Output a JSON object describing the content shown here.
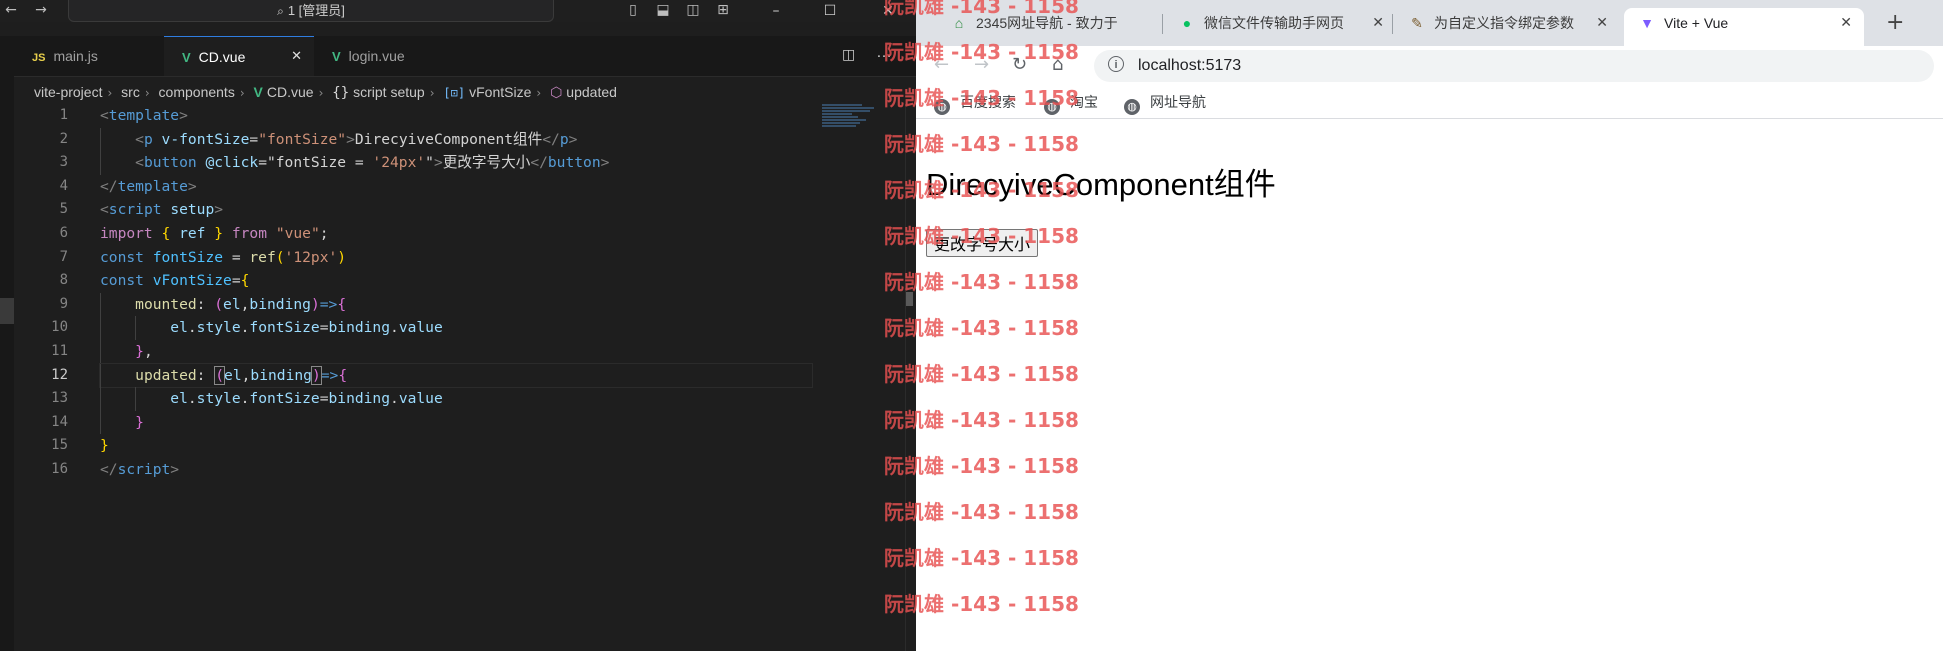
{
  "vscode": {
    "command_center": "1 [管理员]",
    "tabs": [
      {
        "label": "main.js",
        "icon": "JS"
      },
      {
        "label": "CD.vue",
        "icon": "V"
      },
      {
        "label": "login.vue",
        "icon": "V"
      }
    ],
    "breadcrumb": [
      "vite-project",
      "src",
      "components",
      "CD.vue",
      "script setup",
      "vFontSize",
      "updated"
    ],
    "line_numbers": [
      "1",
      "2",
      "3",
      "4",
      "5",
      "6",
      "7",
      "8",
      "9",
      "10",
      "11",
      "12",
      "13",
      "14",
      "15",
      "16"
    ],
    "code": {
      "l1_a": "<",
      "l1_b": "template",
      "l1_c": ">",
      "l2_a": "<",
      "l2_b": "p",
      "l2_c": "v-fontSize",
      "l2_d": "=",
      "l2_e": "\"fontSize\"",
      "l2_f": ">",
      "l2_g": "DirecyiveComponent组件",
      "l2_h": "</",
      "l2_i": "p",
      "l2_j": ">",
      "l3_a": "<",
      "l3_b": "button",
      "l3_c": "@click",
      "l3_d": "=",
      "l3_e": "\"fontSize = ",
      "l3_f": "'24px'",
      "l3_g": "\"",
      "l3_h": ">",
      "l3_i": "更改字号大小",
      "l3_j": "</",
      "l3_k": "button",
      "l3_l": ">",
      "l4_a": "</",
      "l4_b": "template",
      "l4_c": ">",
      "l5_a": "<",
      "l5_b": "script",
      "l5_c": "setup",
      "l5_d": ">",
      "l6_a": "import",
      "l6_b": "{",
      "l6_c": "ref",
      "l6_d": "}",
      "l6_e": "from",
      "l6_f": "\"vue\"",
      "l6_g": ";",
      "l7_a": "const",
      "l7_b": "fontSize",
      "l7_c": " = ",
      "l7_d": "ref",
      "l7_e": "(",
      "l7_f": "'12px'",
      "l7_g": ")",
      "l8_a": "const",
      "l8_b": "vFontSize",
      "l8_c": "=",
      "l8_d": "{",
      "l9_a": "mounted",
      "l9_b": ": ",
      "l9_c": "(",
      "l9_d": "el",
      "l9_e": ",",
      "l9_f": "binding",
      "l9_g": ")",
      "l9_h": "=>",
      "l9_i": "{",
      "l10_a": "el",
      "l10_b": ".",
      "l10_c": "style",
      "l10_d": ".",
      "l10_e": "fontSize",
      "l10_f": "=",
      "l10_g": "binding",
      "l10_h": ".",
      "l10_i": "value",
      "l11_a": "}",
      "l11_b": ",",
      "l12_a": "updated",
      "l12_b": ": ",
      "l12_c": "(",
      "l12_d": "el",
      "l12_e": ",",
      "l12_f": "binding",
      "l12_g": ")",
      "l12_h": "=>",
      "l12_i": "{",
      "l13_a": "el",
      "l13_b": ".",
      "l13_c": "style",
      "l13_d": ".",
      "l13_e": "fontSize",
      "l13_f": "=",
      "l13_g": "binding",
      "l13_h": ".",
      "l13_i": "value",
      "l14_a": "}",
      "l15_a": "}",
      "l16_a": "</",
      "l16_b": "script",
      "l16_c": ">"
    }
  },
  "browser": {
    "tabs": [
      {
        "label": "2345网址导航 - 致力于"
      },
      {
        "label": "微信文件传输助手网页"
      },
      {
        "label": "为自定义指令绑定参数"
      },
      {
        "label": "Vite + Vue"
      }
    ],
    "url": "localhost:5173",
    "bookmarks": [
      "百度搜索",
      "淘宝",
      "网址导航"
    ],
    "page": {
      "paragraph": "DirecyiveComponent组件",
      "button": "更改字号大小"
    }
  },
  "watermark": {
    "text": "阮凯雄 -143 - 1158"
  },
  "colors": {
    "vscode_bg": "#1e1e1e",
    "accent_blue": "#2f7de1",
    "vue_green": "#42b883",
    "watermark_red": "#e85050"
  }
}
